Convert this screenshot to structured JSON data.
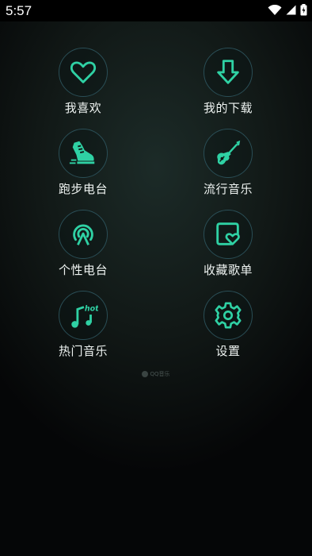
{
  "status_bar": {
    "time": "5:57",
    "icons": [
      "wifi-icon",
      "signal-icon",
      "battery-charging-icon"
    ]
  },
  "accent_color": "#2fd1a4",
  "menu": {
    "items": [
      {
        "label": "我喜欢",
        "icon": "heart-icon"
      },
      {
        "label": "我的下载",
        "icon": "download-arrow-icon"
      },
      {
        "label": "跑步电台",
        "icon": "running-shoe-icon"
      },
      {
        "label": "流行音乐",
        "icon": "electric-guitar-icon"
      },
      {
        "label": "个性电台",
        "icon": "radio-broadcast-icon"
      },
      {
        "label": "收藏歌单",
        "icon": "favorite-playlist-icon"
      },
      {
        "label": "热门音乐",
        "icon": "hot-music-note-icon"
      },
      {
        "label": "设置",
        "icon": "gear-icon"
      }
    ]
  },
  "footer": {
    "text": "QQ音乐",
    "icon": "qq-music-logo-icon"
  }
}
